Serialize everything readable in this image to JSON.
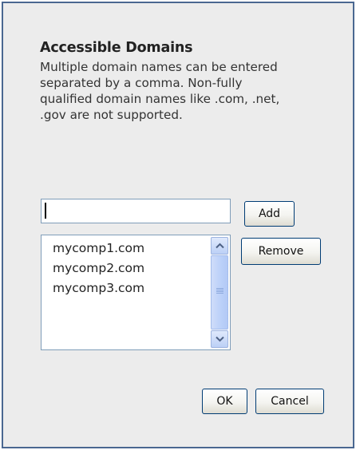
{
  "dialog": {
    "title": "Accessible Domains",
    "description": "Multiple domain names can be entered separated by a comma. Non-fully qualified domain names like .com, .net, .gov are not supported."
  },
  "input": {
    "value": ""
  },
  "buttons": {
    "add": "Add",
    "remove": "Remove",
    "ok": "OK",
    "cancel": "Cancel"
  },
  "domains": [
    "mycomp1.com",
    "mycomp2.com",
    "mycomp3.com"
  ],
  "scrollbar": {
    "up_icon": "chevron-up-icon",
    "down_icon": "chevron-down-icon",
    "grip_icon": "grip-icon"
  },
  "colors": {
    "dialog_border": "#4a6791",
    "dialog_background": "#ececec",
    "button_border": "#003c74",
    "input_border": "#7f9db9"
  }
}
